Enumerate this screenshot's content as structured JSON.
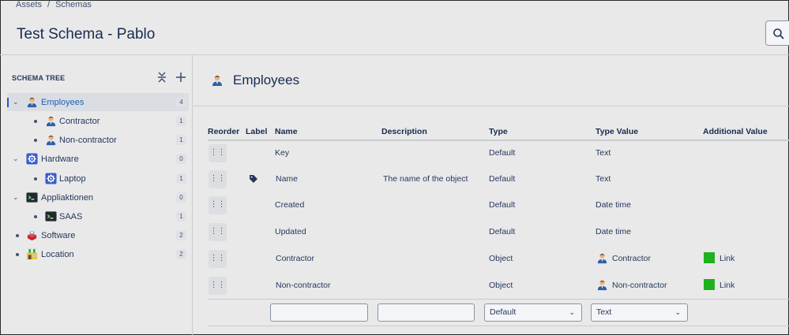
{
  "breadcrumb": [
    "Assets",
    "/",
    "Schemas"
  ],
  "page_title": "Test Schema - Pablo",
  "search": {
    "icon": "search-icon"
  },
  "sidebar": {
    "title": "SCHEMA TREE",
    "actions": [
      "collapse-all-icon",
      "add-icon"
    ],
    "items": [
      {
        "label": "Employees",
        "count": "4",
        "icon": "person-icon",
        "level": 0,
        "expanded": true,
        "selected": true
      },
      {
        "label": "Contractor",
        "count": "1",
        "icon": "person-icon",
        "level": 1
      },
      {
        "label": "Non-contractor",
        "count": "1",
        "icon": "person-icon",
        "level": 1
      },
      {
        "label": "Hardware",
        "count": "0",
        "icon": "gear-icon",
        "level": 0,
        "expanded": true
      },
      {
        "label": "Laptop",
        "count": "1",
        "icon": "gear-icon",
        "level": 1
      },
      {
        "label": "Appliaktionen",
        "count": "0",
        "icon": "terminal-icon",
        "level": 0,
        "expanded": true
      },
      {
        "label": "SAAS",
        "count": "1",
        "icon": "terminal-icon",
        "level": 1
      },
      {
        "label": "Software",
        "count": "2",
        "icon": "software-icon",
        "level": 0
      },
      {
        "label": "Location",
        "count": "2",
        "icon": "store-icon",
        "level": 0
      }
    ]
  },
  "main": {
    "type_title": "Employees",
    "type_icon": "person-icon",
    "columns": [
      "Reorder",
      "Label",
      "Name",
      "Description",
      "Type",
      "Type Value",
      "Additional Value"
    ],
    "rows": [
      {
        "label_icon": "",
        "name": "Key",
        "description": "",
        "type": "Default",
        "type_value": "Text",
        "additional": ""
      },
      {
        "label_icon": "tag-icon",
        "name": "Name",
        "description": "The name of the object",
        "type": "Default",
        "type_value": "Text",
        "additional": ""
      },
      {
        "label_icon": "",
        "name": "Created",
        "description": "",
        "type": "Default",
        "type_value": "Date time",
        "additional": ""
      },
      {
        "label_icon": "",
        "name": "Updated",
        "description": "",
        "type": "Default",
        "type_value": "Date time",
        "additional": ""
      },
      {
        "label_icon": "",
        "name": "Contractor",
        "description": "",
        "type": "Object",
        "type_value": "Contractor",
        "type_value_icon": "person-icon",
        "additional": "Link"
      },
      {
        "label_icon": "",
        "name": "Non-contractor",
        "description": "",
        "type": "Object",
        "type_value": "Non-contractor",
        "type_value_icon": "person-icon",
        "additional": "Link"
      }
    ],
    "new_row": {
      "name_placeholder": "",
      "description_placeholder": "",
      "type_select": "Default",
      "type_value_select": "Text"
    }
  },
  "colors": {
    "link": "#1fb11f",
    "selected_text": "#1d5fb8",
    "selected_bg": "#dadde2"
  }
}
